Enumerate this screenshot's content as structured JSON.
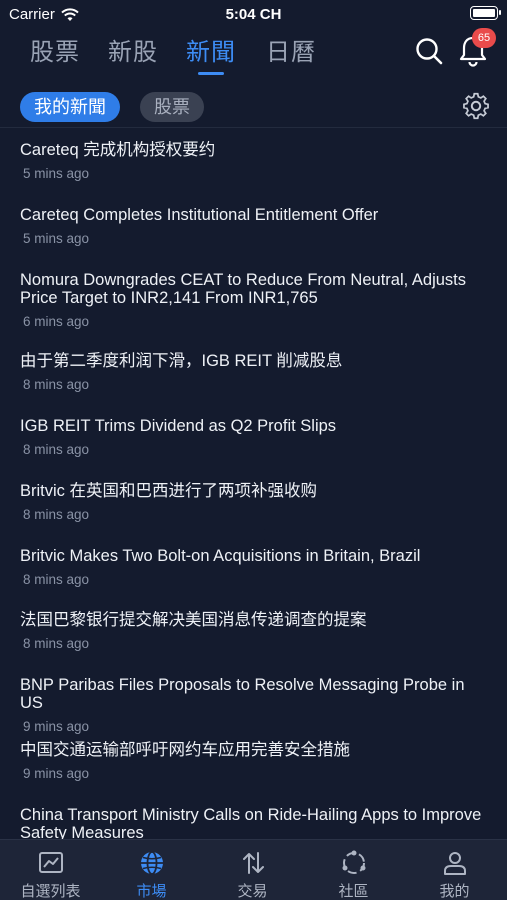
{
  "status": {
    "carrier": "Carrier",
    "time": "5:04 CH"
  },
  "top_tabs": [
    {
      "label": "股票",
      "active": false
    },
    {
      "label": "新股",
      "active": false
    },
    {
      "label": "新聞",
      "active": true
    },
    {
      "label": "日曆",
      "active": false
    }
  ],
  "notifications": {
    "count": "65",
    "icon": "bell-icon"
  },
  "sub_tabs": {
    "active": "我的新聞",
    "inactive": "股票"
  },
  "news": [
    {
      "title": "Careteq 完成机构授权要约",
      "time": "5 mins ago"
    },
    {
      "title": "Careteq Completes Institutional Entitlement Offer",
      "time": "5 mins ago"
    },
    {
      "title": "Nomura Downgrades CEAT to Reduce From Neutral, Adjusts Price Target to INR2,141 From INR1,765",
      "time": "6 mins ago"
    },
    {
      "title": "由于第二季度利润下滑，IGB REIT 削减股息",
      "time": "8 mins ago"
    },
    {
      "title": "IGB REIT Trims Dividend as Q2 Profit Slips",
      "time": "8 mins ago"
    },
    {
      "title": "Britvic 在英国和巴西进行了两项补强收购",
      "time": "8 mins ago"
    },
    {
      "title": "Britvic Makes Two Bolt-on Acquisitions in Britain, Brazil",
      "time": "8 mins ago"
    },
    {
      "title": "法国巴黎银行提交解决美国消息传递调查的提案",
      "time": "8 mins ago"
    },
    {
      "title": "BNP Paribas Files Proposals to Resolve Messaging Probe in US",
      "time": "9 mins ago"
    },
    {
      "title": "中国交通运输部呼吁网约车应用完善安全措施",
      "time": "9 mins ago"
    },
    {
      "title": "China Transport Ministry Calls on Ride-Hailing Apps to Improve Safety Measures",
      "time": ""
    }
  ],
  "bottom_tabs": [
    {
      "label": "自選列表",
      "icon": "chart-icon",
      "active": false
    },
    {
      "label": "市場",
      "icon": "globe-icon",
      "active": true
    },
    {
      "label": "交易",
      "icon": "transfer-icon",
      "active": false
    },
    {
      "label": "社區",
      "icon": "community-icon",
      "active": false
    },
    {
      "label": "我的",
      "icon": "person-icon",
      "active": false
    }
  ],
  "colors": {
    "background": "#141b2e",
    "accent": "#3d8cf4",
    "badge": "#e94b4b",
    "tab_bar": "#1e2538"
  }
}
